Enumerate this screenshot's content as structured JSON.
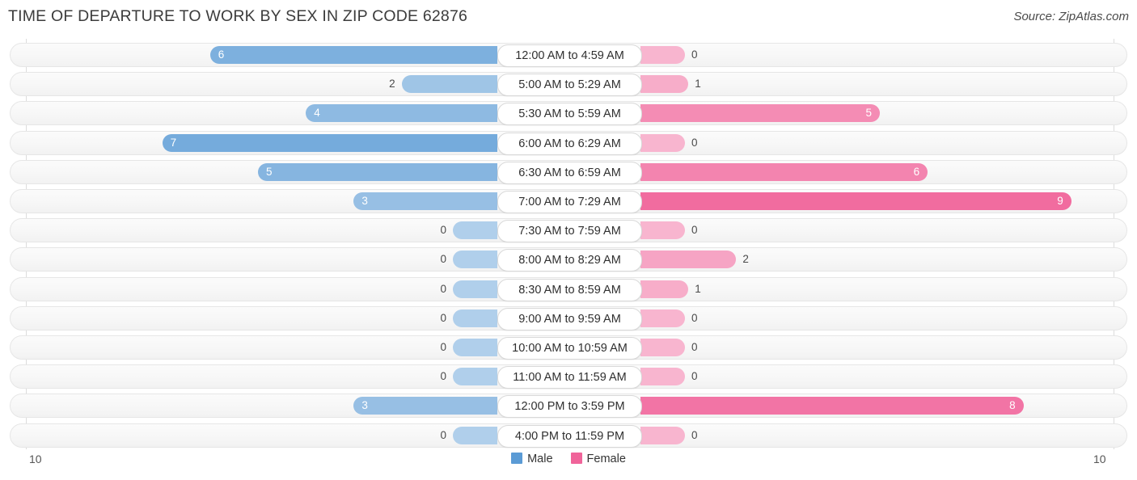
{
  "header": {
    "title": "TIME OF DEPARTURE TO WORK BY SEX IN ZIP CODE 62876",
    "source": "Source: ZipAtlas.com"
  },
  "legend": {
    "male_label": "Male",
    "female_label": "Female",
    "male_color": "#5b9bd5",
    "female_color": "#f0649a"
  },
  "axis": {
    "left_label": "10",
    "right_label": "10",
    "max": 10
  },
  "chart_data": {
    "type": "bar",
    "orientation": "horizontal-diverging",
    "title": "TIME OF DEPARTURE TO WORK BY SEX IN ZIP CODE 62876",
    "xlabel": "",
    "ylabel": "",
    "xlim": [
      10,
      10
    ],
    "grid": true,
    "legend_position": "bottom-center",
    "categories": [
      "12:00 AM to 4:59 AM",
      "5:00 AM to 5:29 AM",
      "5:30 AM to 5:59 AM",
      "6:00 AM to 6:29 AM",
      "6:30 AM to 6:59 AM",
      "7:00 AM to 7:29 AM",
      "7:30 AM to 7:59 AM",
      "8:00 AM to 8:29 AM",
      "8:30 AM to 8:59 AM",
      "9:00 AM to 9:59 AM",
      "10:00 AM to 10:59 AM",
      "11:00 AM to 11:59 AM",
      "12:00 PM to 3:59 PM",
      "4:00 PM to 11:59 PM"
    ],
    "series": [
      {
        "name": "Male",
        "color": "#5b9bd5",
        "values": [
          6,
          2,
          4,
          7,
          5,
          3,
          0,
          0,
          0,
          0,
          0,
          0,
          3,
          0
        ]
      },
      {
        "name": "Female",
        "color": "#f0649a",
        "values": [
          0,
          1,
          5,
          0,
          6,
          9,
          0,
          2,
          1,
          0,
          0,
          0,
          8,
          0
        ]
      }
    ]
  }
}
